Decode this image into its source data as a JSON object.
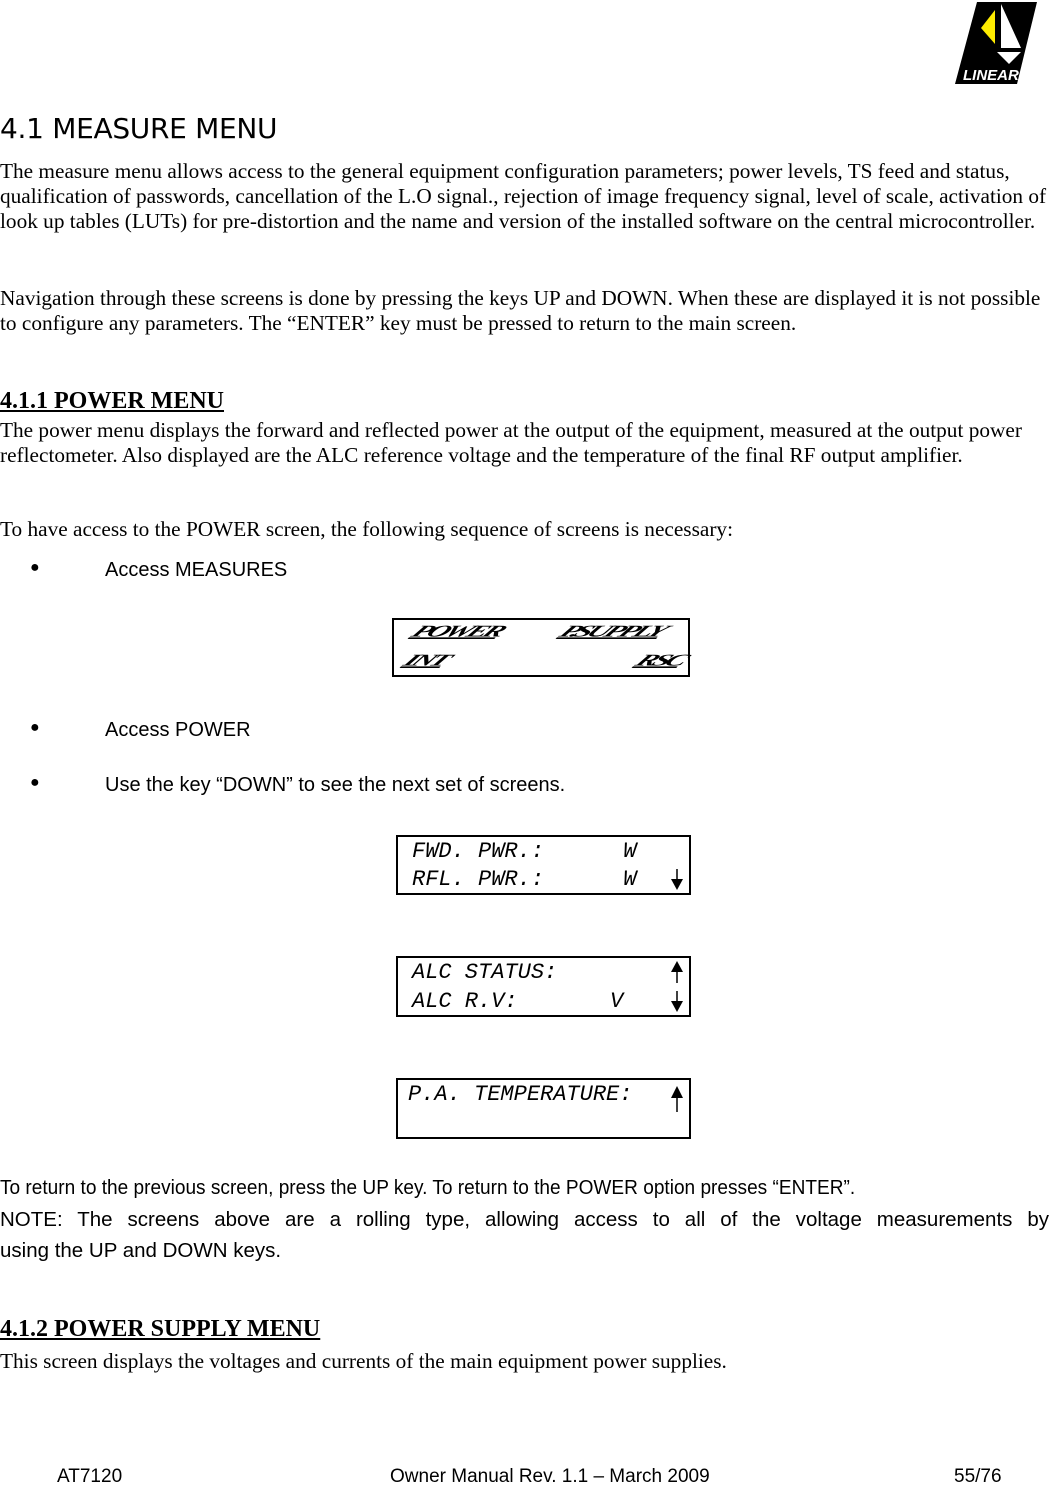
{
  "header": {
    "logo": {
      "name": "linear-logo",
      "text": "LINEAR",
      "colors": {
        "primary": "#000000",
        "accent": "#ffec00",
        "light": "#ffffff"
      }
    }
  },
  "section": {
    "title": "4.1 MEASURE MENU",
    "paragraphs": [
      "The measure menu allows access to the general equipment configuration parameters; power levels, TS feed and status, qualification of passwords, cancellation of the L.O signal., rejection of image frequency signal, level of scale, activation of look up tables (LUTs) for pre-distortion and the name and version of the installed software on the central microcontroller.",
      "Navigation through these screens is done by pressing the keys UP and DOWN. When these are displayed it is not possible to configure any parameters. The “ENTER” key must be pressed to return to the main screen."
    ]
  },
  "subsection_power": {
    "title": "4.1.1 POWER MENU",
    "paragraphs": [
      "The power menu displays the forward and reflected power at the output of the equipment, measured at the output power reflectometer. Also displayed are the ALC reference voltage and the temperature of the final RF output amplifier.",
      "To have access to the POWER screen, the following sequence of screens is necessary:"
    ],
    "steps": [
      "Access MEASURES",
      "Access POWER",
      "Use the key “DOWN” to see the next set of screens."
    ],
    "measures_screen": {
      "row1_left": "POWER",
      "row1_right": "P.SUPPLY",
      "row2_left": "INT",
      "row2_right": "RSC"
    },
    "screens": [
      {
        "line1": "FWD. PWR.:      W",
        "line2": "RFL. PWR.:      W",
        "up_arrow": false,
        "down_arrow": true
      },
      {
        "line1": "ALC STATUS:",
        "line2": "ALC R.V:       V",
        "up_arrow": true,
        "down_arrow": true
      },
      {
        "line1": "P.A. TEMPERATURE:",
        "line2": "",
        "up_arrow": true,
        "down_arrow": false
      }
    ],
    "after_text": "To return to the previous screen, press the UP key. To return to the POWER option presses “ENTER”.",
    "note_line1": "NOTE: The screens above are a rolling type, allowing access to all of the voltage measurements by",
    "note_line2": "using the UP and DOWN keys."
  },
  "subsection_supply": {
    "title": "4.1.2 POWER SUPPLY MENU",
    "paragraph": "This screen displays the voltages and currents of the main equipment power supplies."
  },
  "footer": {
    "model": "AT7120",
    "manual": "Owner Manual Rev. 1.1 – March 2009",
    "page": "55/76"
  }
}
